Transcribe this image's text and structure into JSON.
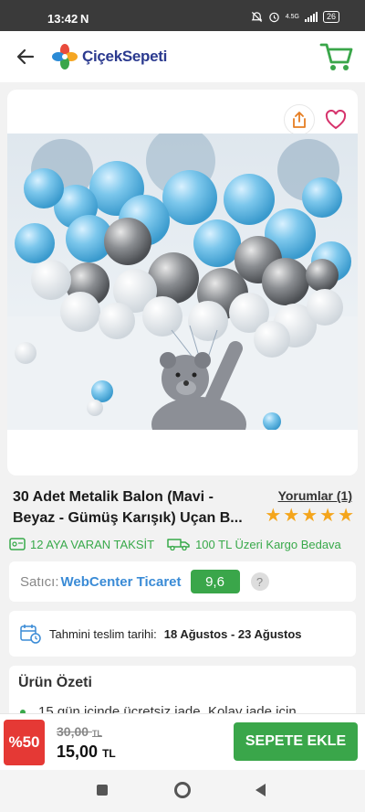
{
  "status_bar": {
    "time": "13:42",
    "carrier_icon": "N",
    "network": "4.5G",
    "battery": "26"
  },
  "header": {
    "brand": "ÇiçekSepeti"
  },
  "product": {
    "title": "30 Adet Metalik Balon (Mavi - Beyaz - Gümüş Karışık) Uçan B...",
    "reviews_link": "Yorumlar (1)",
    "stars": 5
  },
  "badges": {
    "installment": "12 AYA VARAN TAKSİT",
    "shipping": "100 TL Üzeri Kargo Bedava"
  },
  "seller": {
    "label": "Satıcı:",
    "name": "WebCenter Ticaret",
    "score": "9,6",
    "help": "?"
  },
  "delivery": {
    "label": "Tahmini teslim tarihi:",
    "value": "18 Ağustos - 23 Ağustos"
  },
  "summary": {
    "heading": "Ürün Özeti",
    "first_item": "15 gün içinde ücretsiz iade. Kolay iade için"
  },
  "purchase": {
    "discount": "%50",
    "old_price": "30,00",
    "old_currency": "TL",
    "new_price": "15,00",
    "new_currency": "TL",
    "add_to_cart": "SEPETE EKLE"
  },
  "colors": {
    "accent_green": "#3aa64a",
    "brand_blue": "#2b3a8f",
    "link_blue": "#3a8bd6",
    "discount_red": "#e53935",
    "star": "#f4a51c"
  }
}
